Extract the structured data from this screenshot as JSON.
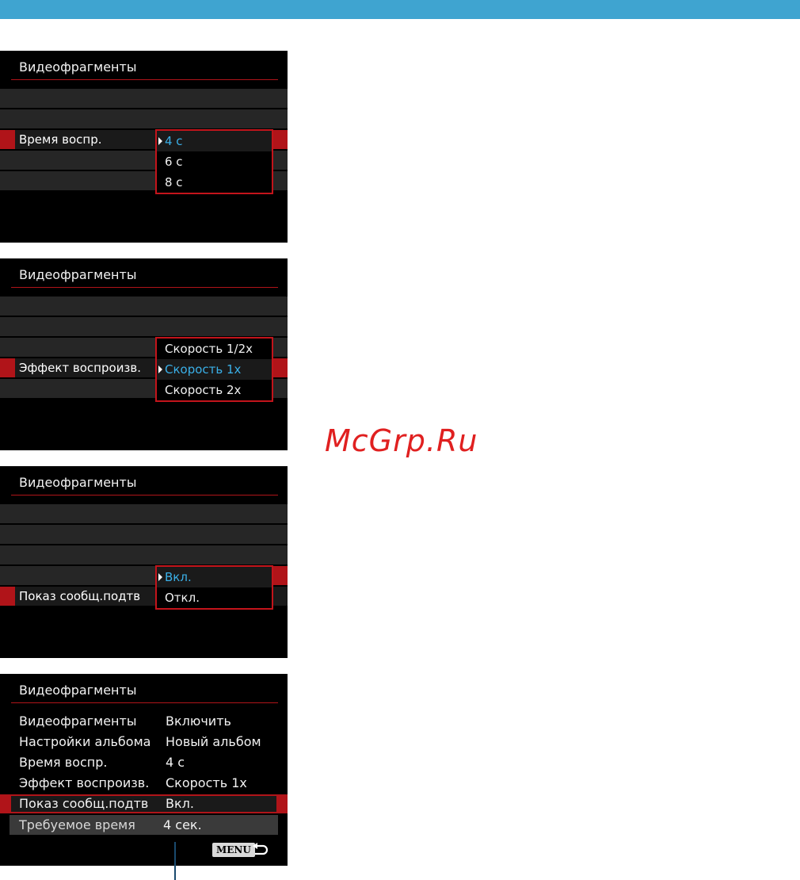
{
  "colors": {
    "top_bar": "#3fa4d0",
    "screen_bg": "#000000",
    "accent_red": "#c3141b",
    "selected_text": "#3ab0e8",
    "watermark": "#e02020"
  },
  "screens": [
    {
      "title": "Видеофрагменты",
      "row_label": "Время воспр.",
      "options": [
        "4 с",
        "6 с",
        "8 с"
      ],
      "selected_option": "4 с"
    },
    {
      "title": "Видеофрагменты",
      "row_label": "Эффект воспроизв.",
      "options": [
        "Скорость 1/2x",
        "Скорость 1x",
        "Скорость 2x"
      ],
      "selected_option": "Скорость 1x"
    },
    {
      "title": "Видеофрагменты",
      "row_label": "Показ сообщ.подтв",
      "options": [
        "Вкл.",
        "Откл."
      ],
      "selected_option": "Вкл."
    }
  ],
  "summary_screen": {
    "title": "Видеофрагменты",
    "rows": [
      {
        "label": "Видеофрагменты",
        "value": "Включить"
      },
      {
        "label": "Настройки альбома",
        "value": "Новый альбом"
      },
      {
        "label": "Время воспр.",
        "value": "4 с"
      },
      {
        "label": "Эффект воспроизв.",
        "value": "Скорость 1x"
      },
      {
        "label": "Показ сообщ.подтв",
        "value": "Вкл."
      },
      {
        "label": "Требуемое время",
        "value": "4 сек."
      }
    ],
    "menu_button": "MENU",
    "back_icon": "return-arrow-icon"
  },
  "watermark": "McGrp.Ru"
}
